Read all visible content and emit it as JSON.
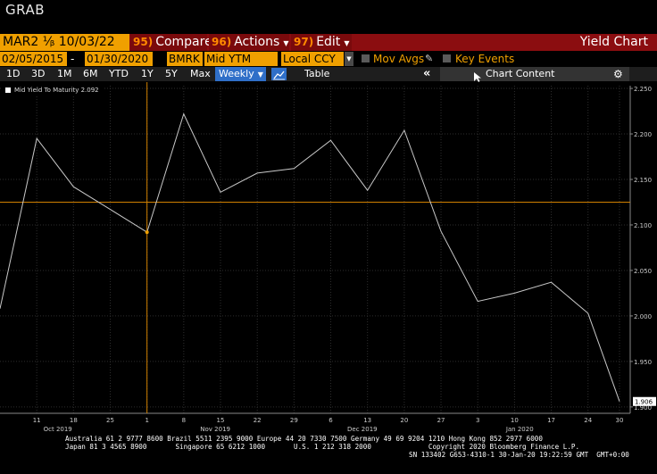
{
  "window": {
    "title": "GRAB"
  },
  "toolbar": {
    "security": "MAR2 ⅟ᵦ 10/03/22",
    "compare": {
      "badge": "95)",
      "label": "Compare"
    },
    "actions": {
      "badge": "96)",
      "label": "Actions"
    },
    "edit": {
      "badge": "97)",
      "label": "Edit"
    },
    "screen_name": "Yield Chart"
  },
  "options": {
    "start_date": "02/05/2015",
    "date_separator": "-",
    "end_date": "01/30/2020",
    "source": "BMRK",
    "field": "Mid YTM",
    "currency": "Local CCY",
    "mov_avgs_label": "Mov Avgs",
    "key_events_label": "Key Events"
  },
  "range_bar": {
    "ranges": [
      "1D",
      "3D",
      "1M",
      "6M",
      "YTD",
      "1Y",
      "5Y",
      "Max"
    ],
    "frequency": "Weekly",
    "table_label": "Table",
    "collapse_symbol": "«",
    "chart_content_label": "Chart Content"
  },
  "legend": {
    "label": "Mid Yield To Maturity 2.092"
  },
  "chart_data": {
    "type": "line",
    "series": [
      {
        "name": "Mid Yield To Maturity",
        "x": [
          "2019-10-04",
          "2019-10-11",
          "2019-10-18",
          "2019-10-25",
          "2019-11-01",
          "2019-11-08",
          "2019-11-15",
          "2019-11-22",
          "2019-11-29",
          "2019-12-06",
          "2019-12-13",
          "2019-12-20",
          "2019-12-27",
          "2020-01-03",
          "2020-01-10",
          "2020-01-17",
          "2020-01-24",
          "2020-01-30"
        ],
        "y": [
          2.008,
          2.195,
          2.142,
          2.117,
          2.092,
          2.222,
          2.136,
          2.157,
          2.162,
          2.193,
          2.138,
          2.204,
          2.093,
          2.016,
          2.025,
          2.037,
          2.003,
          1.906
        ]
      }
    ],
    "x_ticks": [
      "11",
      "18",
      "25",
      "1",
      "8",
      "15",
      "22",
      "29",
      "6",
      "13",
      "20",
      "27",
      "3",
      "10",
      "17",
      "24",
      "30"
    ],
    "month_labels": [
      "Oct 2019",
      "Nov 2019",
      "Dec 2019",
      "Jan 2020"
    ],
    "y_ticks": [
      "2.250",
      "2.200",
      "2.150",
      "2.100",
      "2.050",
      "2.000",
      "1.950",
      "1.900"
    ],
    "ylim": [
      1.893,
      2.253
    ],
    "last_value_label": "1.906",
    "crosshair": {
      "x": "2019-11-01",
      "y": 2.125
    },
    "grid": true,
    "colors": {
      "line": "#c8c8c8",
      "crosshair": "#d08000",
      "grid": "#3a3a3a",
      "marker": "#f0a000"
    }
  },
  "footer": {
    "line1": "Australia 61 2 9777 8600 Brazil 5511 2395 9000 Europe 44 20 7330 7500 Germany 49 69 9204 1210 Hong Kong 852 2977 6000",
    "line2": "Japan 81 3 4565 8900       Singapore 65 6212 1000       U.S. 1 212 318 2000              Copyright 2020 Bloomberg Finance L.P.",
    "line3": "SN 133402 G653-4310-1 30-Jan-20 19:22:59 GMT  GMT+0:00"
  }
}
